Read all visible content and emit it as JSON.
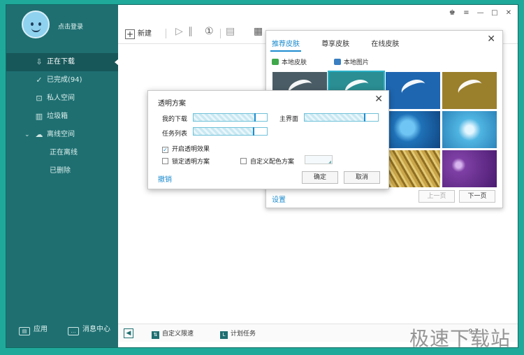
{
  "sidebar": {
    "login_text": "点击登录",
    "items": [
      {
        "label": "正在下载",
        "icon": "download-icon"
      },
      {
        "label": "已完成(94)",
        "icon": "check-circle-icon"
      },
      {
        "label": "私人空间",
        "icon": "lock-icon"
      },
      {
        "label": "垃圾箱",
        "icon": "trash-icon"
      },
      {
        "label": "离线空间",
        "icon": "cloud-icon"
      },
      {
        "label": "正在离线"
      },
      {
        "label": "已删除"
      }
    ],
    "app_label": "应用",
    "msg_label": "消息中心"
  },
  "toolbar": {
    "new_label": "新建"
  },
  "status_bar": {
    "speed_label": "自定义限速",
    "plan_label": "计划任务",
    "count_text": "9.7"
  },
  "skin_dialog": {
    "tabs": [
      "推荐皮肤",
      "尊享皮肤",
      "在线皮肤"
    ],
    "local_skin": "本地皮肤",
    "local_image": "本地图片",
    "settings": "设置",
    "prev": "上一页",
    "next": "下一页",
    "thumbs": [
      {
        "name": "skin-thumb-dark",
        "color": "#4a5d66"
      },
      {
        "name": "skin-thumb-teal",
        "color": "#2a8e93"
      },
      {
        "name": "skin-thumb-blue",
        "color": "#1e66b0"
      },
      {
        "name": "skin-thumb-olive",
        "color": "#9a7f2c"
      },
      {
        "name": "skin-thumb-water",
        "color": "#1f72b8"
      },
      {
        "name": "skin-thumb-feather",
        "color": "#4fb5e2"
      },
      {
        "name": "skin-thumb-grass",
        "color": "#b8973f"
      },
      {
        "name": "skin-thumb-purple",
        "color": "#7e3fa4"
      }
    ]
  },
  "trans_dialog": {
    "title": "透明方案",
    "my_download": "我的下载",
    "main_ui": "主界面",
    "task_list": "任务列表",
    "enable_label": "开启透明效果",
    "lock_label": "锁定透明方案",
    "custom_label": "自定义配色方案",
    "undo": "撤销",
    "ok": "确定",
    "cancel": "取消",
    "my_download_level": 0.83,
    "main_ui_level": 0.81,
    "task_list_level": 0.81,
    "enable_checked": true,
    "lock_checked": false,
    "custom_checked": false
  },
  "watermark": "极速下载站",
  "colors": {
    "sidebar": "#1f6f71",
    "accent": "#1d8ccf",
    "background": "#1fa99b"
  }
}
